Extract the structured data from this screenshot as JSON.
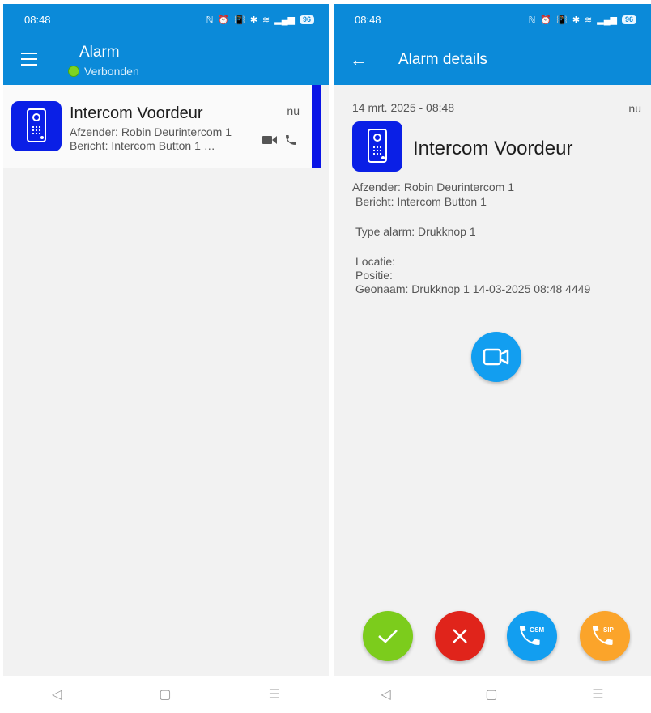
{
  "status": {
    "time": "08:48",
    "battery": "96"
  },
  "list_screen": {
    "title": "Alarm",
    "connection": "Verbonden",
    "item": {
      "title": "Intercom Voordeur",
      "sender": "Afzender: Robin Deurintercom 1",
      "message": "Bericht: Intercom Button 1 …",
      "time": "nu"
    }
  },
  "detail_screen": {
    "title": "Alarm details",
    "datetime": "14 mrt. 2025 - 08:48",
    "time": "nu",
    "alarm_title": "Intercom Voordeur",
    "sender": "Afzender: Robin Deurintercom 1",
    "message": "Bericht: Intercom Button 1",
    "type": "Type alarm: Drukknop 1",
    "location": "Locatie:",
    "position": "Positie:",
    "geoname": "Geonaam: Drukknop 1 14-03-2025 08:48 4449",
    "actions": {
      "gsm_label": "GSM",
      "sip_label": "SIP"
    }
  },
  "nav": {
    "back": "◁",
    "home": "▢",
    "menu": "☰"
  },
  "colors": {
    "primary": "#0b8ad9",
    "accept": "#7ccc1c",
    "reject": "#e0241b",
    "gsm": "#129ef0",
    "sip": "#fba42a",
    "item_bar": "#0a14e6"
  }
}
